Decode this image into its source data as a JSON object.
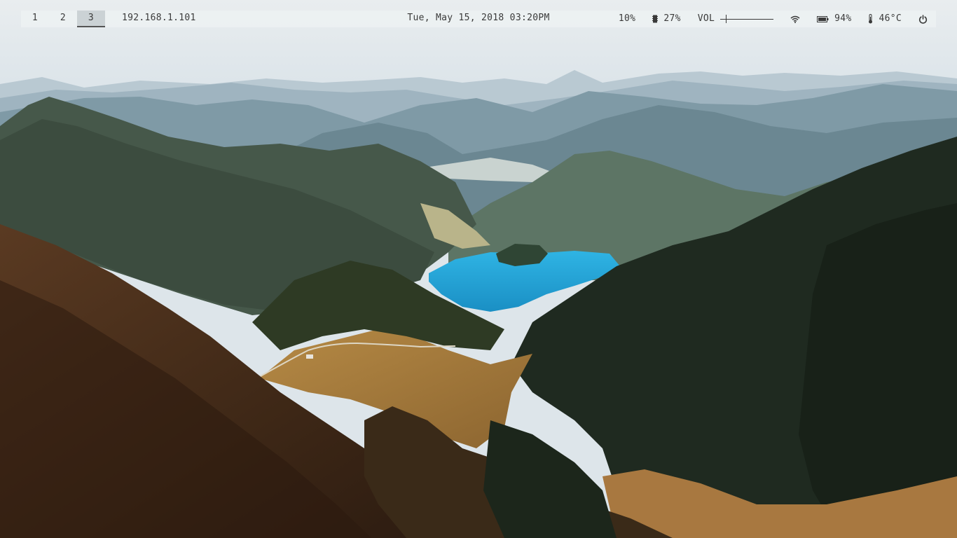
{
  "workspaces": [
    {
      "label": "1",
      "active": false
    },
    {
      "label": "2",
      "active": false
    },
    {
      "label": "3",
      "active": true
    }
  ],
  "network": {
    "ip": "192.168.1.101"
  },
  "clock": {
    "text": "Tue, May 15, 2018 03:20PM"
  },
  "status": {
    "cpu": {
      "value": "10%"
    },
    "memory": {
      "icon": "memory-icon",
      "value": "27%"
    },
    "volume": {
      "label": "VOL",
      "level": 0.1
    },
    "wifi": {
      "icon": "wifi-icon"
    },
    "battery": {
      "icon": "battery-icon",
      "value": "94%"
    },
    "temperature": {
      "icon": "thermometer-icon",
      "value": "46°C"
    },
    "power": {
      "icon": "power-icon"
    }
  },
  "colors": {
    "bar_text": "#3a3a3a",
    "lake": "#2ea6d8",
    "forest": "#1f2a20"
  }
}
